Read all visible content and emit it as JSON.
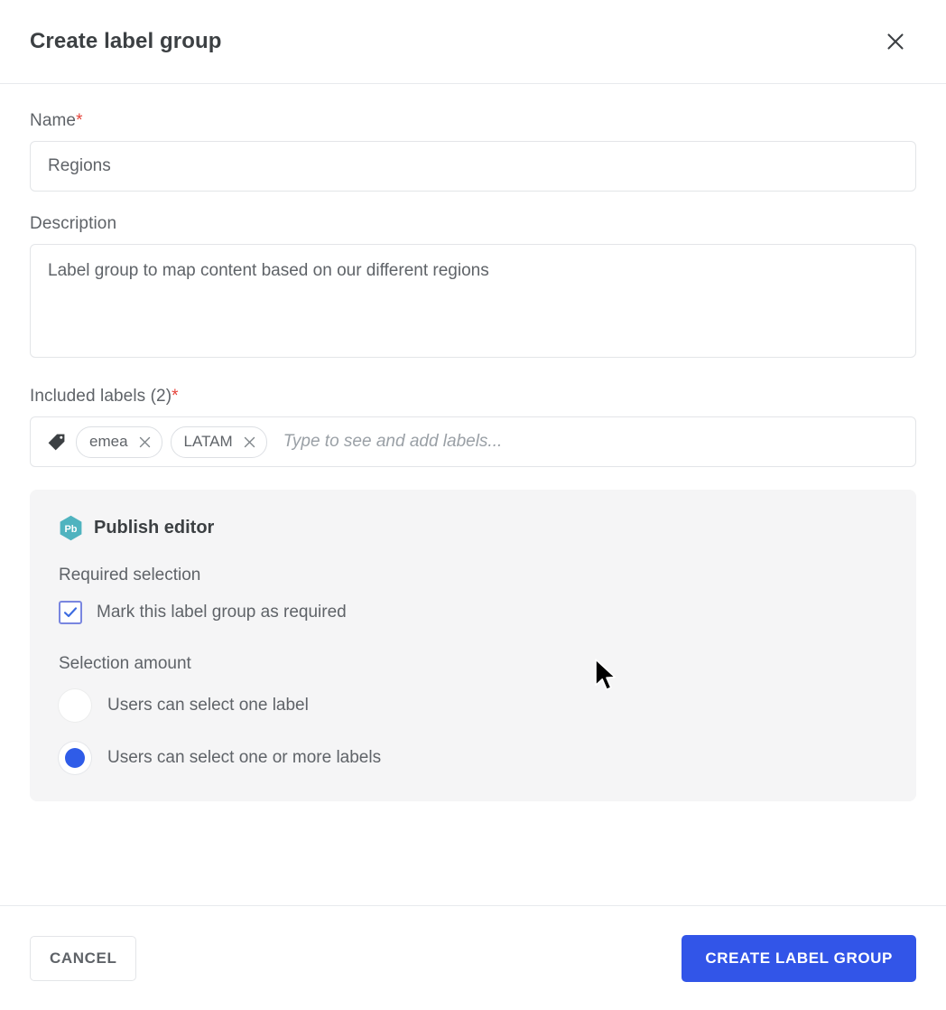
{
  "dialog": {
    "title": "Create label group",
    "close_icon": "close-icon"
  },
  "form": {
    "name": {
      "label": "Name",
      "required_marker": "*",
      "value": "Regions",
      "placeholder": ""
    },
    "description": {
      "label": "Description",
      "value": "Label group to map content based on our different regions",
      "placeholder": ""
    },
    "included_labels": {
      "label": "Included labels (2)",
      "required_marker": "*",
      "tag_icon": "tag-icon",
      "chips": [
        {
          "text": "emea",
          "remove_icon": "close-icon"
        },
        {
          "text": "LATAM",
          "remove_icon": "close-icon"
        }
      ],
      "placeholder": "Type to see and add labels..."
    }
  },
  "panel": {
    "badge_text": "Pb",
    "badge_icon": "publish-hexagon-icon",
    "title": "Publish editor",
    "required_selection": {
      "section_label": "Required selection",
      "checkbox_label": "Mark this label group as required",
      "checked": true
    },
    "selection_amount": {
      "section_label": "Selection amount",
      "options": [
        {
          "label": "Users can select one label",
          "selected": false
        },
        {
          "label": "Users can select one or more labels",
          "selected": true
        }
      ]
    }
  },
  "footer": {
    "cancel_label": "CANCEL",
    "submit_label": "CREATE LABEL GROUP"
  },
  "colors": {
    "primary_blue": "#3255e8",
    "radio_blue": "#2f5ce8",
    "checkbox_border": "#7986e0",
    "required_red": "#e5443b",
    "panel_bg": "#f5f5f6",
    "badge_teal": "#4fb3bf"
  }
}
